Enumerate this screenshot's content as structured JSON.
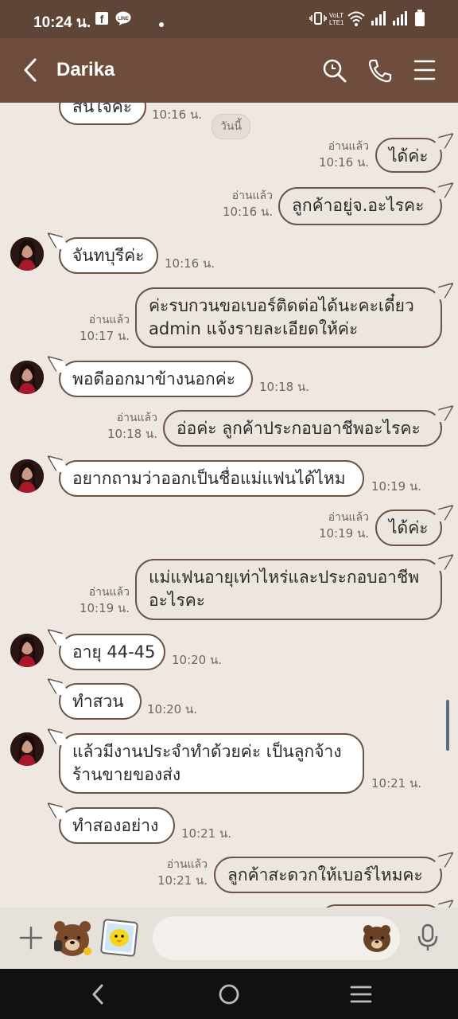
{
  "status_bar": {
    "time": "10:24 น."
  },
  "header": {
    "contact_name": "Darika",
    "icons": [
      "back-icon",
      "search-icon",
      "phone-icon",
      "menu-icon"
    ]
  },
  "chat": {
    "date_chip": "วันนี้",
    "top_partial": {
      "text": "สนใจค่ะ",
      "time": "10:16 น."
    },
    "messages": [
      {
        "dir": "out",
        "read": "อ่านแล้ว",
        "time": "10:16 น.",
        "text": [
          "ได้ค่ะ"
        ]
      },
      {
        "dir": "out",
        "read": "อ่านแล้ว",
        "time": "10:16 น.",
        "text": [
          "ลูกค้าอยู่จ.อะไรคะ"
        ]
      },
      {
        "dir": "in",
        "time": "10:16 น.",
        "text": [
          "จันทบุรีค่ะ"
        ]
      },
      {
        "dir": "out",
        "read": "อ่านแล้ว",
        "time": "10:17 น.",
        "text": [
          "ค่ะรบกวนขอเบอร์ติดต่อได้นะคะเดี๋ยว",
          "admin แจ้งรายละเอียดให้ค่ะ"
        ]
      },
      {
        "dir": "in",
        "time": "10:18 น.",
        "text": [
          "พอดีออกมาข้างนอกค่ะ"
        ]
      },
      {
        "dir": "out",
        "read": "อ่านแล้ว",
        "time": "10:18 น.",
        "text": [
          "อ่อค่ะ ลูกค้าประกอบอาชีพอะไรคะ"
        ]
      },
      {
        "dir": "in",
        "time": "10:19 น.",
        "text": [
          "อยากถามว่าออกเป็นชื่อแม่แฟนได้ไหม"
        ]
      },
      {
        "dir": "out",
        "read": "อ่านแล้ว",
        "time": "10:19 น.",
        "text": [
          "ได้ค่ะ"
        ]
      },
      {
        "dir": "out",
        "read": "อ่านแล้ว",
        "time": "10:19 น.",
        "text": [
          "แม่แฟนอายุเท่าไหร่และประกอบอาชีพ",
          "อะไรคะ"
        ]
      },
      {
        "dir": "in",
        "time": "10:20 น.",
        "text": [
          "อายุ 44-45"
        ]
      },
      {
        "dir": "in",
        "time": "10:20 น.",
        "text": [
          "ทำสวน"
        ]
      },
      {
        "dir": "in",
        "time": "10:21 น.",
        "text": [
          "แล้วมีงานประจำทำด้วยค่ะ เป็นลูกจ้าง",
          "ร้านขายของส่ง"
        ]
      },
      {
        "dir": "in",
        "time": "10:21 น.",
        "text": [
          "ทำสองอย่าง"
        ]
      },
      {
        "dir": "out",
        "read": "อ่านแล้ว",
        "time": "10:21 น.",
        "text": [
          "ลูกค้าสะดวกให้เบอร์ไหมคะ"
        ]
      }
    ]
  },
  "input_bar": {
    "icons": [
      "plus-icon",
      "sticker-brown-icon",
      "sticker-sally-icon",
      "emoji-icon",
      "mic-icon"
    ]
  },
  "nav_bar": {
    "icons": [
      "nav-back-icon",
      "nav-home-icon",
      "nav-recents-icon"
    ]
  },
  "colors": {
    "header": "#6f4d3c",
    "status": "#5e4537",
    "background": "#efe8e2",
    "bubble_border": "#6b5446"
  }
}
